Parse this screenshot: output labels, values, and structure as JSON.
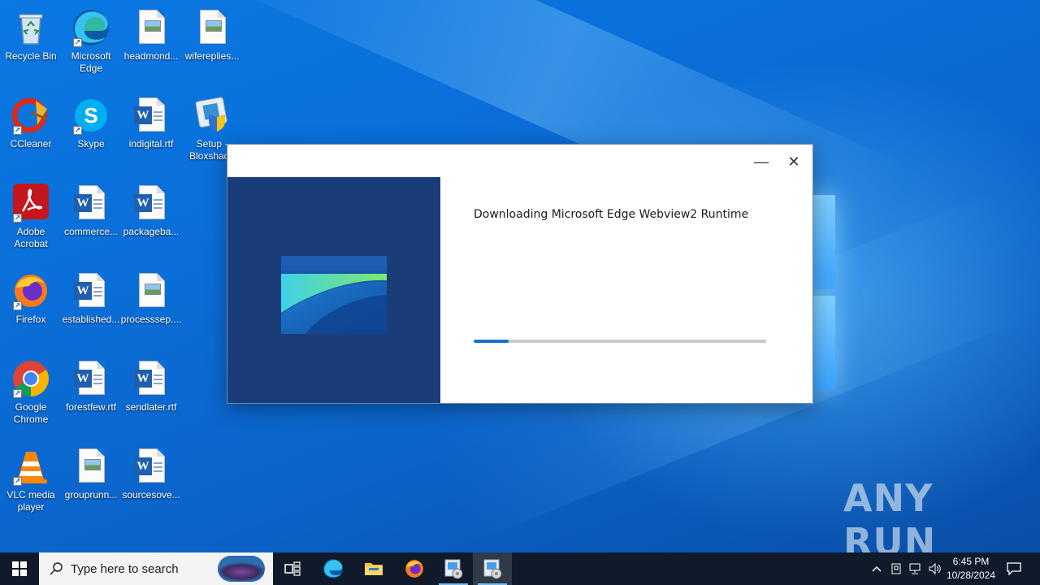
{
  "desktop": {
    "icons": [
      {
        "label": "Recycle Bin"
      },
      {
        "label": "Microsoft Edge"
      },
      {
        "label": "headmond..."
      },
      {
        "label": "wifereplies..."
      },
      {
        "label": "CCleaner"
      },
      {
        "label": "Skype"
      },
      {
        "label": "indigital.rtf"
      },
      {
        "label": "Setup - Bloxshade"
      },
      {
        "label": "Adobe Acrobat"
      },
      {
        "label": "commerce..."
      },
      {
        "label": "packageba..."
      },
      {
        "label": "Firefox"
      },
      {
        "label": "established..."
      },
      {
        "label": "processsep...."
      },
      {
        "label": "Google Chrome"
      },
      {
        "label": "forestfew.rtf"
      },
      {
        "label": "sendlater.rtf"
      },
      {
        "label": "VLC media player"
      },
      {
        "label": "grouprunn..."
      },
      {
        "label": "sourcesove..."
      }
    ]
  },
  "installer": {
    "title_text": "Downloading Microsoft Edge Webview2 Runtime",
    "minimize_glyph": "—",
    "close_glyph": "✕",
    "progress_percent": 12
  },
  "watermark": {
    "text": "ANY RUN"
  },
  "taskbar": {
    "search_placeholder": "Type here to search",
    "clock_time": "6:45 PM",
    "clock_date": "10/28/2024"
  },
  "colors": {
    "installer_left_pane": "#1a3d7a",
    "progress_fill": "#1e6fcf",
    "progress_track": "#c9c9c9",
    "taskbar_bg": "#101a2a"
  }
}
